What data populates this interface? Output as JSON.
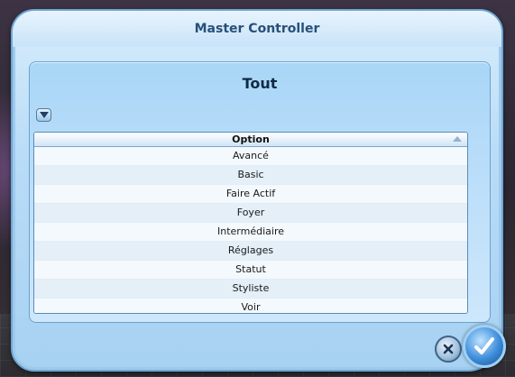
{
  "window": {
    "title": "Master Controller"
  },
  "panel": {
    "heading": "Tout"
  },
  "list": {
    "header": "Option",
    "items": [
      {
        "label": "Avancé"
      },
      {
        "label": "Basic"
      },
      {
        "label": "Faire Actif"
      },
      {
        "label": "Foyer"
      },
      {
        "label": "Intermédiaire"
      },
      {
        "label": "Réglages"
      },
      {
        "label": "Statut"
      },
      {
        "label": "Styliste"
      },
      {
        "label": "Voir"
      }
    ]
  },
  "icons": {
    "dropdown": "chevron-down-icon",
    "sort": "sort-ascending-icon",
    "cancel": "close-icon",
    "ok": "checkmark-icon"
  },
  "colors": {
    "title_text": "#27507a",
    "panel_bg": "#bfe0fa",
    "accent": "#3d8ddb"
  }
}
